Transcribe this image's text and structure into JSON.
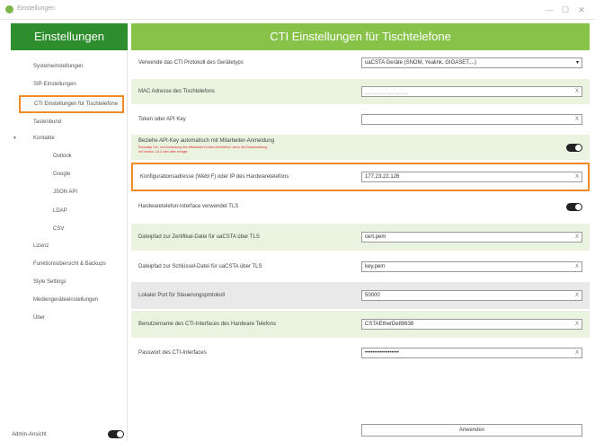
{
  "window": {
    "title": "Einstellungen",
    "minimize": "—",
    "maximize": "☐",
    "close": "✕"
  },
  "sidebar": {
    "header": "Einstellungen",
    "items": [
      {
        "label": "Systemeinstellungen"
      },
      {
        "label": "SIP-Einstellungen"
      },
      {
        "label": "CTI Einstellungen für Tischtelefone"
      },
      {
        "label": "Tastenbund"
      },
      {
        "label": "Kontakte"
      },
      {
        "label": "Outlook"
      },
      {
        "label": "Google"
      },
      {
        "label": "JSON API"
      },
      {
        "label": "LDAP"
      },
      {
        "label": "CSV"
      },
      {
        "label": "Lizenz"
      },
      {
        "label": "Funktionsübersicht & Backups"
      },
      {
        "label": "Style Settings"
      },
      {
        "label": "Mediengeräteeinstellungen"
      },
      {
        "label": "Über"
      }
    ],
    "admin_label": "Admin-Ansicht",
    "admin_toggle": true
  },
  "main": {
    "header": "CTI Einstellungen für Tischtelefone",
    "rows": [
      {
        "label": "Verwende das CTI Protokoll des Gerätetyps",
        "value": "uaCSTA Geräte (SNOM, Yealink, GIGASET,...)"
      },
      {
        "label": "MAC Adresse des Tischtelefons",
        "value": "__:__:__:__:__:__"
      },
      {
        "label": "Token oder API Key",
        "value": ""
      },
      {
        "label": "Beziehe API-Key automatisch mit Mitarbeiter-Anmeldung",
        "note1": "Einmalige Hin- und Anmeldung des Mitarbeiter-Kontos erforderlich, wenn die Erstanmeldung",
        "note2": "mit Version 1.8.3 oder älter erfolgte.",
        "toggle": true
      },
      {
        "label": "Konfigurationsadresse (Webl F) oder IP des Hardwaretelefons",
        "value": "177.23.22.126"
      },
      {
        "label": "Hardwaretelefon-Interface verwendet TLS",
        "toggle": true
      },
      {
        "label": "Dateipfad zur Zertifikat-Datei für uaCSTA über TLS",
        "value": "cert.pem"
      },
      {
        "label": "Dateipfad zur Schlüssel-Datei für uaCSTA über TLS",
        "value": "key.pem"
      },
      {
        "label": "Lokaler Port für Steuerungsprotokoll",
        "value": "50000"
      },
      {
        "label": "Benutzername des CTI-Interfaces des Hardware Telefons",
        "value": "CSTAEtherDe89638"
      },
      {
        "label": "Passwort des CTI-Interfaces",
        "value": "••••••••••••••••••"
      }
    ],
    "apply_button": "Anwenden",
    "clear_glyph": "X",
    "dropdown_glyph": "▾"
  }
}
